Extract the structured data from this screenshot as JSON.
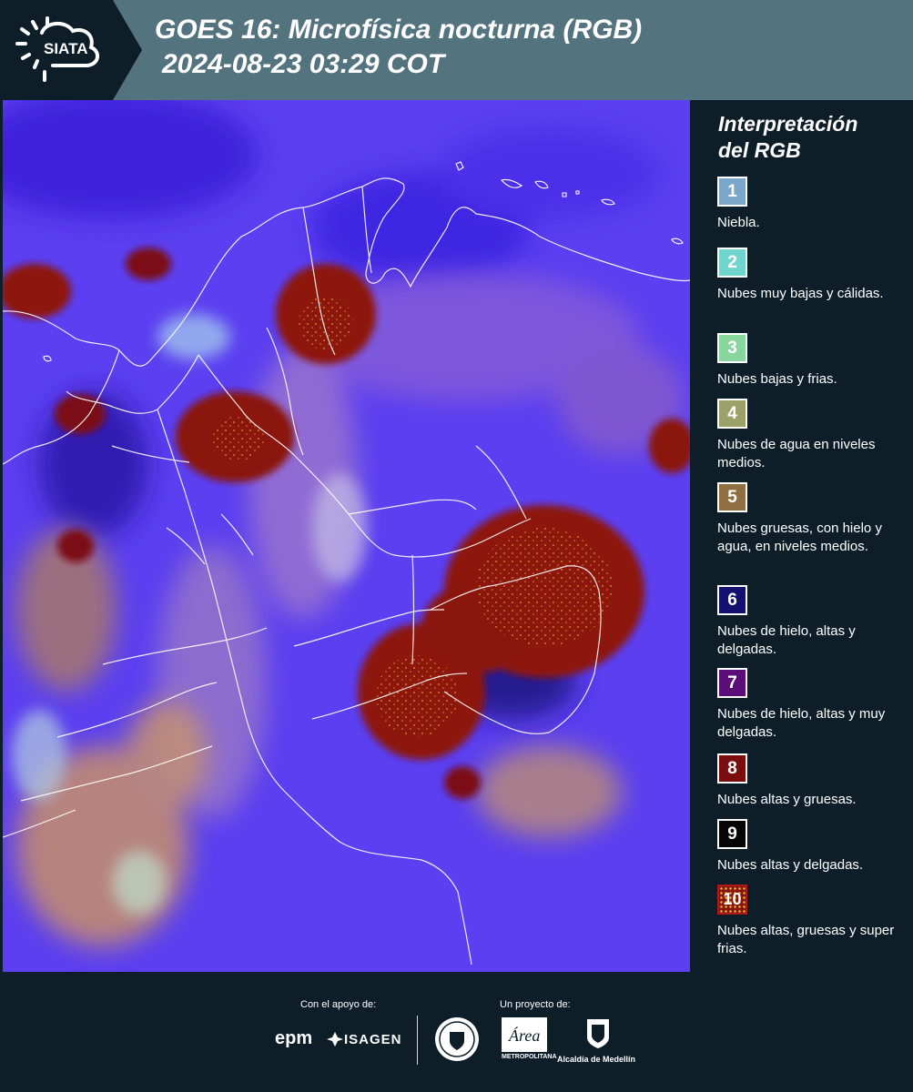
{
  "header": {
    "logo_text": "SIATA",
    "title_line1": "GOES 16: Microfísica nocturna (RGB)",
    "title_line2": "2024-08-23 03:29 COT",
    "bg_color": "#53737f"
  },
  "legend": {
    "title_line1": "Interpretación",
    "title_line2": "del RGB",
    "items": [
      {
        "num": "1",
        "label": "Niebla.",
        "color": "#7ba5c9"
      },
      {
        "num": "2",
        "label": "Nubes muy bajas y cálidas.",
        "color": "#6fd5cf"
      },
      {
        "num": "3",
        "label": "Nubes bajas y frias.",
        "color": "#87d69d"
      },
      {
        "num": "4",
        "label": "Nubes de agua en niveles medios.",
        "color": "#9aa26a"
      },
      {
        "num": "5",
        "label": "Nubes gruesas, con hielo y agua, en niveles medios.",
        "color": "#8f6f42"
      },
      {
        "num": "6",
        "label": "Nubes de hielo, altas y delgadas.",
        "color": "#131070"
      },
      {
        "num": "7",
        "label": "Nubes de hielo, altas y muy delgadas.",
        "color": "#5b0e78"
      },
      {
        "num": "8",
        "label": "Nubes altas y gruesas.",
        "color": "#7c0d0f"
      },
      {
        "num": "9",
        "label": "Nubes altas y delgadas.",
        "color": "#050505"
      },
      {
        "num": "10",
        "label": "Nubes altas, gruesas y super frias.",
        "color": "#8b1410"
      }
    ]
  },
  "footer": {
    "support_label": "Con el apoyo de:",
    "project_label": "Un proyecto de:",
    "sponsor1": "epm",
    "sponsor2": "ISAGEN",
    "partner1_caption": "METROPOLITANA",
    "partner1_logo": "Área",
    "partner2_caption": "Alcaldía de Medellín"
  }
}
